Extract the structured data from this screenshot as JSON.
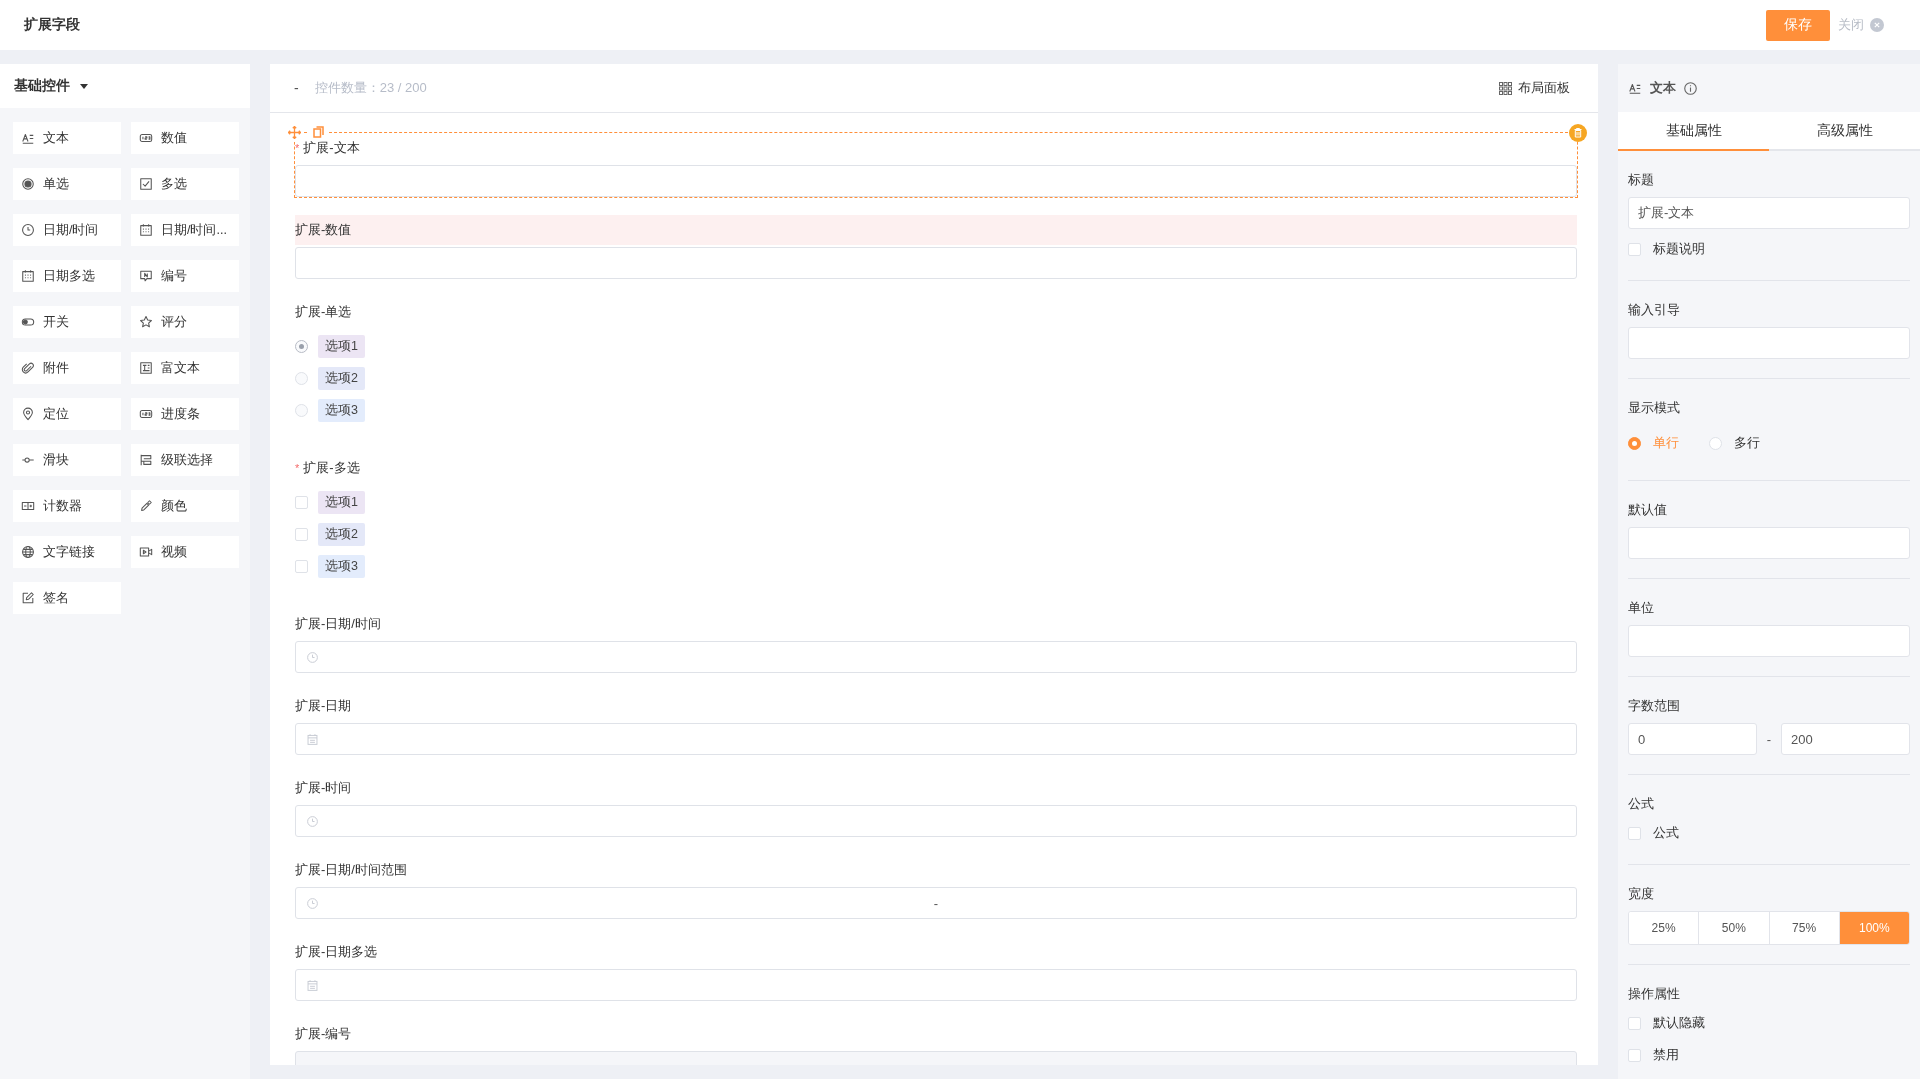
{
  "header": {
    "title": "扩展字段",
    "save_button": "保存",
    "close_label": "关闭"
  },
  "palette": {
    "title": "基础控件",
    "items": [
      {
        "label": "文本",
        "kind": "text"
      },
      {
        "label": "数值",
        "kind": "number"
      },
      {
        "label": "单选",
        "kind": "radio"
      },
      {
        "label": "多选",
        "kind": "checkbox"
      },
      {
        "label": "日期/时间",
        "kind": "datetime"
      },
      {
        "label": "日期/时间...",
        "kind": "datetime_range"
      },
      {
        "label": "日期多选",
        "kind": "date_multi"
      },
      {
        "label": "编号",
        "kind": "serial"
      },
      {
        "label": "开关",
        "kind": "switch"
      },
      {
        "label": "评分",
        "kind": "rating"
      },
      {
        "label": "附件",
        "kind": "attachment"
      },
      {
        "label": "富文本",
        "kind": "richtext"
      },
      {
        "label": "定位",
        "kind": "location"
      },
      {
        "label": "进度条",
        "kind": "progress"
      },
      {
        "label": "滑块",
        "kind": "slider"
      },
      {
        "label": "级联选择",
        "kind": "cascade"
      },
      {
        "label": "计数器",
        "kind": "counter"
      },
      {
        "label": "颜色",
        "kind": "color"
      },
      {
        "label": "文字链接",
        "kind": "link"
      },
      {
        "label": "视频",
        "kind": "video"
      },
      {
        "label": "签名",
        "kind": "signature"
      }
    ]
  },
  "canvas": {
    "collapse": "-",
    "count_label": "控件数量：23 / 200",
    "layout_button": "布局面板",
    "fields": [
      {
        "kind": "text",
        "label": "扩展-文本",
        "required_mark": "*",
        "selected": true,
        "highlighted": false
      },
      {
        "kind": "number",
        "label": "扩展-数值",
        "selected": false,
        "highlighted": true
      },
      {
        "kind": "radio",
        "label": "扩展-单选",
        "selected": false,
        "highlighted": false,
        "options": [
          {
            "label": "选项1",
            "selected": true,
            "color": "#ece5f4"
          },
          {
            "label": "选项2",
            "selected": false,
            "color": "#e4e8f8"
          },
          {
            "label": "选项3",
            "selected": false,
            "color": "#e3ecfc"
          }
        ]
      },
      {
        "kind": "checkbox",
        "label": "扩展-多选",
        "required_mark": "*",
        "selected": false,
        "highlighted": false,
        "options": [
          {
            "label": "选项1",
            "checked": false,
            "color": "#ece5f4"
          },
          {
            "label": "选项2",
            "checked": false,
            "color": "#e4e8f8"
          },
          {
            "label": "选项3",
            "checked": false,
            "color": "#e3ecfc"
          }
        ]
      },
      {
        "kind": "datetime",
        "label": "扩展-日期/时间",
        "selected": false,
        "highlighted": false
      },
      {
        "kind": "date",
        "label": "扩展-日期",
        "selected": false,
        "highlighted": false
      },
      {
        "kind": "time",
        "label": "扩展-时间",
        "selected": false,
        "highlighted": false
      },
      {
        "kind": "datetime_range",
        "label": "扩展-日期/时间范围",
        "selected": false,
        "highlighted": false,
        "separator": "-"
      },
      {
        "kind": "date_multi",
        "label": "扩展-日期多选",
        "selected": false,
        "highlighted": false
      },
      {
        "kind": "serial",
        "label": "扩展-编号",
        "selected": false,
        "highlighted": false
      }
    ]
  },
  "properties": {
    "title": "文本",
    "tabs": [
      {
        "label": "基础属性",
        "selected": true
      },
      {
        "label": "高级属性",
        "selected": false
      }
    ],
    "sections": [
      {
        "title": "标题",
        "controls": [
          {
            "kind": "input",
            "value": "扩展-文本"
          },
          {
            "kind": "checkbox",
            "label": "标题说明",
            "checked": false
          }
        ]
      },
      {
        "title": "输入引导",
        "controls": [
          {
            "kind": "input"
          }
        ]
      },
      {
        "title": "显示模式",
        "controls": [
          {
            "kind": "radios",
            "options": [
              {
                "label": "单行",
                "selected": true
              },
              {
                "label": "多行",
                "selected": false
              }
            ]
          }
        ]
      },
      {
        "title": "默认值",
        "controls": [
          {
            "kind": "input"
          }
        ]
      },
      {
        "title": "单位",
        "controls": [
          {
            "kind": "input"
          }
        ]
      },
      {
        "title": "字数范围",
        "controls": [
          {
            "kind": "range",
            "from": "0",
            "separator": "-",
            "to": "200"
          }
        ]
      },
      {
        "title": "公式",
        "controls": [
          {
            "kind": "checkbox",
            "label": "公式",
            "checked": false
          }
        ]
      },
      {
        "title": "宽度",
        "controls": [
          {
            "kind": "segments",
            "options": [
              {
                "label": "25%",
                "selected": false
              },
              {
                "label": "50%",
                "selected": false
              },
              {
                "label": "75%",
                "selected": false
              },
              {
                "label": "100%",
                "selected": true
              }
            ]
          }
        ]
      },
      {
        "title": "操作属性",
        "controls": [
          {
            "kind": "checkbox",
            "label": "默认隐藏",
            "checked": false
          },
          {
            "kind": "checkbox",
            "label": "禁用",
            "checked": false
          }
        ]
      }
    ]
  }
}
